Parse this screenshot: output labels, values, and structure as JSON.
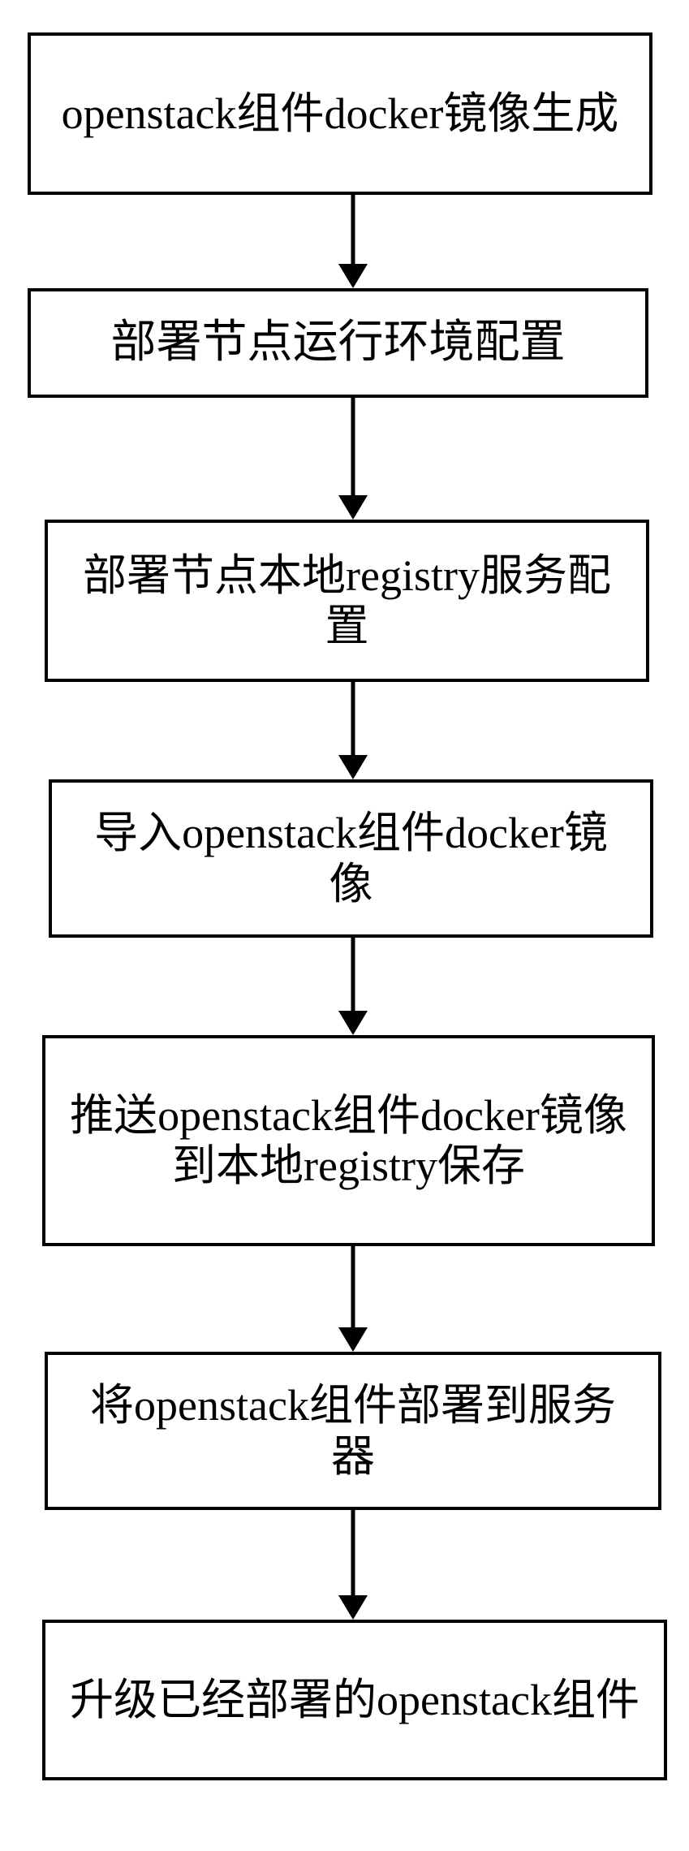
{
  "chart_data": {
    "type": "flowchart",
    "direction": "top-to-bottom",
    "nodes": [
      {
        "id": "n1",
        "label": "openstack组件docker镜像生成"
      },
      {
        "id": "n2",
        "label": "部署节点运行环境配置"
      },
      {
        "id": "n3",
        "label": "部署节点本地registry服务配置"
      },
      {
        "id": "n4",
        "label": "导入openstack组件docker镜像"
      },
      {
        "id": "n5",
        "label": "推送openstack组件docker镜像到本地registry保存"
      },
      {
        "id": "n6",
        "label": "将openstack组件部署到服务器"
      },
      {
        "id": "n7",
        "label": "升级已经部署的openstack组件"
      }
    ],
    "edges": [
      {
        "from": "n1",
        "to": "n2"
      },
      {
        "from": "n2",
        "to": "n3"
      },
      {
        "from": "n3",
        "to": "n4"
      },
      {
        "from": "n4",
        "to": "n5"
      },
      {
        "from": "n5",
        "to": "n6"
      },
      {
        "from": "n6",
        "to": "n7"
      }
    ]
  }
}
